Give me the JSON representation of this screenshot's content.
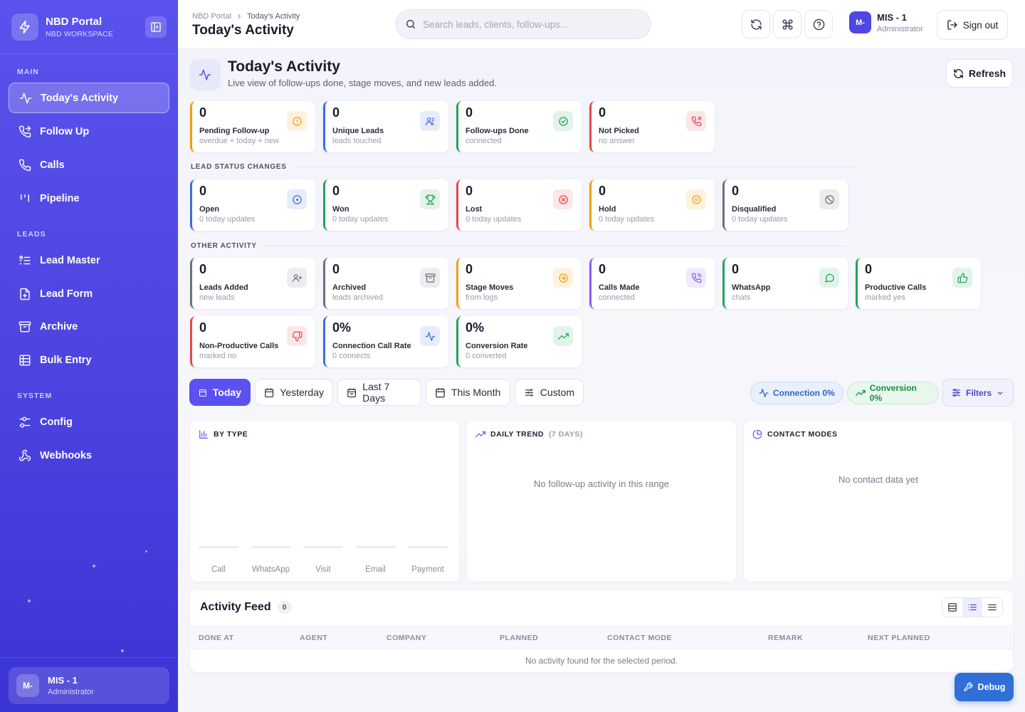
{
  "brand": {
    "title": "NBD Portal",
    "subtitle": "NBD WORKSPACE"
  },
  "sidebar": {
    "sections": [
      {
        "label": "MAIN"
      },
      {
        "label": "LEADS"
      },
      {
        "label": "SYSTEM"
      }
    ],
    "items": [
      {
        "label": "Today's Activity",
        "icon": "activity-icon",
        "active": true
      },
      {
        "label": "Follow Up",
        "icon": "phone-forward-icon"
      },
      {
        "label": "Calls",
        "icon": "phone-icon"
      },
      {
        "label": "Pipeline",
        "icon": "pipeline-icon"
      },
      {
        "label": "Lead Master",
        "icon": "list-icon"
      },
      {
        "label": "Lead Form",
        "icon": "file-plus-icon"
      },
      {
        "label": "Archive",
        "icon": "archive-icon"
      },
      {
        "label": "Bulk Entry",
        "icon": "table-icon"
      },
      {
        "label": "Config",
        "icon": "sliders-icon"
      },
      {
        "label": "Webhooks",
        "icon": "webhook-icon"
      }
    ],
    "user": {
      "initials": "M-",
      "name": "MIS - 1",
      "role": "Administrator"
    }
  },
  "topbar": {
    "breadcrumb": [
      "NBD Portal",
      "Today's Activity"
    ],
    "title": "Today's Activity",
    "search_placeholder": "Search leads, clients, follow-ups...",
    "user": {
      "initials": "M-",
      "name": "MIS - 1",
      "role": "Administrator"
    },
    "signout_label": "Sign out"
  },
  "page": {
    "title": "Today's Activity",
    "subtitle": "Live view of follow-ups done, stage moves, and new leads added.",
    "refresh_label": "Refresh"
  },
  "summary": [
    {
      "value": "0",
      "label": "Pending Follow-up",
      "sub": "overdue + today + new",
      "color": "#f59e0b",
      "icon": "alert-circle-icon"
    },
    {
      "value": "0",
      "label": "Unique Leads",
      "sub": "leads touched",
      "color": "#3b6fd6",
      "icon": "users-icon"
    },
    {
      "value": "0",
      "label": "Follow-ups Done",
      "sub": "connected",
      "color": "#22a35a",
      "icon": "check-circle-icon"
    },
    {
      "value": "0",
      "label": "Not Picked",
      "sub": "no answer",
      "color": "#e5484d",
      "icon": "phone-missed-icon"
    }
  ],
  "lead_status": {
    "label": "LEAD STATUS CHANGES",
    "items": [
      {
        "value": "0",
        "label": "Open",
        "sub": "0 today updates",
        "color": "#3b6fd6",
        "icon": "circle-dot-icon"
      },
      {
        "value": "0",
        "label": "Won",
        "sub": "0 today updates",
        "color": "#22a35a",
        "icon": "trophy-icon"
      },
      {
        "value": "0",
        "label": "Lost",
        "sub": "0 today updates",
        "color": "#e5484d",
        "icon": "x-circle-icon"
      },
      {
        "value": "0",
        "label": "Hold",
        "sub": "0 today updates",
        "color": "#f59e0b",
        "icon": "pause-circle-icon"
      },
      {
        "value": "0",
        "label": "Disqualified",
        "sub": "0 today updates",
        "color": "#6b7280",
        "icon": "ban-icon"
      }
    ]
  },
  "other": {
    "label": "OTHER ACTIVITY",
    "items": [
      {
        "value": "0",
        "label": "Leads Added",
        "sub": "new leads",
        "color": "#6b7280",
        "icon": "user-plus-icon"
      },
      {
        "value": "0",
        "label": "Archived",
        "sub": "leads archived",
        "color": "#6b7280",
        "icon": "archive-icon"
      },
      {
        "value": "0",
        "label": "Stage Moves",
        "sub": "from logs",
        "color": "#f59e0b",
        "icon": "arrow-right-circle-icon"
      },
      {
        "value": "0",
        "label": "Calls Made",
        "sub": "connected",
        "color": "#8b5cf6",
        "icon": "phone-call-icon"
      },
      {
        "value": "0",
        "label": "WhatsApp",
        "sub": "chats",
        "color": "#22a35a",
        "icon": "message-circle-icon"
      },
      {
        "value": "0",
        "label": "Productive Calls",
        "sub": "marked yes",
        "color": "#22a35a",
        "icon": "thumbs-up-icon"
      },
      {
        "value": "0",
        "label": "Non-Productive Calls",
        "sub": "marked no",
        "color": "#e5484d",
        "icon": "thumbs-down-icon"
      },
      {
        "value": "0%",
        "label": "Connection Call Rate",
        "sub": "0 connects",
        "color": "#3b6fd6",
        "icon": "activity-icon"
      },
      {
        "value": "0%",
        "label": "Conversion Rate",
        "sub": "0 converted",
        "color": "#22a35a",
        "icon": "trending-up-icon"
      }
    ]
  },
  "ranges": [
    {
      "label": "Today",
      "active": true
    },
    {
      "label": "Yesterday"
    },
    {
      "label": "Last 7 Days"
    },
    {
      "label": "This Month"
    },
    {
      "label": "Custom"
    }
  ],
  "pills": {
    "connection": "Connection 0%",
    "conversion": "Conversion 0%",
    "filters": "Filters"
  },
  "panels": {
    "by_type": {
      "title": "BY TYPE",
      "categories": [
        "Call",
        "WhatsApp",
        "Visit",
        "Email",
        "Payment"
      ]
    },
    "trend": {
      "title": "DAILY TREND",
      "muted": "(7 DAYS)",
      "empty": "No follow-up activity in this range"
    },
    "modes": {
      "title": "CONTACT MODES",
      "empty": "No contact data yet"
    }
  },
  "chart_data": {
    "type": "bar",
    "title": "BY TYPE",
    "categories": [
      "Call",
      "WhatsApp",
      "Visit",
      "Email",
      "Payment"
    ],
    "values": [
      0,
      0,
      0,
      0,
      0
    ]
  },
  "feed": {
    "title": "Activity Feed",
    "count": "0",
    "columns": [
      "DONE AT",
      "AGENT",
      "COMPANY",
      "PLANNED",
      "CONTACT MODE",
      "REMARK",
      "NEXT PLANNED"
    ],
    "empty": "No activity found for the selected period."
  },
  "debug_label": "Debug",
  "colors": {
    "accent": "#5b50f0",
    "sidebar": "#4f46e2",
    "debug": "#2f6fd6"
  }
}
